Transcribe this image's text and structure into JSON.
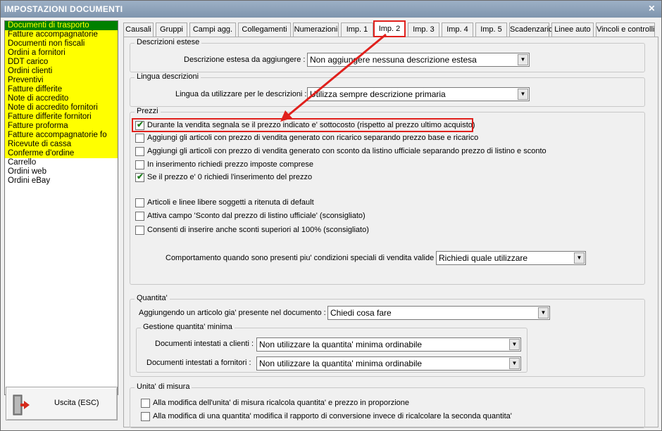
{
  "window": {
    "title": "IMPOSTAZIONI DOCUMENTI",
    "close_glyph": "✕"
  },
  "doc_types": [
    {
      "label": "Documenti di trasporto",
      "state": "selected"
    },
    {
      "label": "Fatture accompagnatorie",
      "state": "yellow"
    },
    {
      "label": "Documenti non fiscali",
      "state": "yellow"
    },
    {
      "label": "Ordini a fornitori",
      "state": "yellow"
    },
    {
      "label": "DDT carico",
      "state": "yellow"
    },
    {
      "label": "Ordini clienti",
      "state": "yellow"
    },
    {
      "label": "Preventivi",
      "state": "yellow"
    },
    {
      "label": "Fatture differite",
      "state": "yellow"
    },
    {
      "label": "Note di accredito",
      "state": "yellow"
    },
    {
      "label": "Note di accredito fornitori",
      "state": "yellow"
    },
    {
      "label": "Fatture differite fornitori",
      "state": "yellow"
    },
    {
      "label": "Fatture proforma",
      "state": "yellow"
    },
    {
      "label": "Fatture accompagnatorie fo",
      "state": "yellow"
    },
    {
      "label": "Ricevute di cassa",
      "state": "yellow"
    },
    {
      "label": "Conferme d'ordine",
      "state": "yellow"
    },
    {
      "label": "Carrello",
      "state": "plain"
    },
    {
      "label": "Ordini web",
      "state": "plain"
    },
    {
      "label": "Ordini eBay",
      "state": "plain"
    }
  ],
  "exit_button": {
    "label": "Uscita (ESC)",
    "icon": "exit-door-icon"
  },
  "tabs": [
    {
      "label": "Causali"
    },
    {
      "label": "Gruppi"
    },
    {
      "label": "Campi agg."
    },
    {
      "label": "Collegamenti"
    },
    {
      "label": "Numerazioni"
    },
    {
      "label": "Imp. 1"
    },
    {
      "label": "Imp. 2"
    },
    {
      "label": "Imp. 3"
    },
    {
      "label": "Imp. 4"
    },
    {
      "label": "Imp. 5"
    },
    {
      "label": "Scadenzario"
    },
    {
      "label": "Linee auto"
    },
    {
      "label": "Vincoli e controlli"
    }
  ],
  "active_tab": "Imp. 2",
  "descrizioni_estese": {
    "title": "Descrizioni estese",
    "label": "Descrizione estesa da aggiungere :",
    "value": "Non aggiungere nessuna descrizione estesa"
  },
  "lingua_descrizioni": {
    "title": "Lingua descrizioni",
    "label": "Lingua da utilizzare per le descrizioni :",
    "value": "Utilizza sempre descrizione primaria"
  },
  "prezzi": {
    "title": "Prezzi",
    "options": [
      {
        "label": "Durante la vendita segnala se il prezzo indicato e' sottocosto (rispetto al prezzo ultimo acquisto)",
        "checked": true
      },
      {
        "label": "Aggiungi gli articoli con prezzo di vendita generato con ricarico separando prezzo base e ricarico",
        "checked": false
      },
      {
        "label": "Aggiungi gli articoli con prezzo di vendita generato con sconto da listino ufficiale separando prezzo di listino e sconto",
        "checked": false
      },
      {
        "label": "In inserimento richiedi prezzo imposte comprese",
        "checked": false
      },
      {
        "label": "Se il prezzo e' 0 richiedi l'inserimento del prezzo",
        "checked": true
      },
      {
        "label": "Articoli e linee libere soggetti a ritenuta di default",
        "checked": false
      },
      {
        "label": "Attiva campo 'Sconto dal prezzo di listino ufficiale' (sconsigliato)",
        "checked": false
      },
      {
        "label": "Consenti di inserire anche sconti superiori al 100% (sconsigliato)",
        "checked": false
      }
    ],
    "condizioni_label": "Comportamento quando sono presenti piu' condizioni speciali di vendita valide :",
    "condizioni_value": "Richiedi quale utilizzare"
  },
  "quantita": {
    "title": "Quantita'",
    "label": "Aggiungendo un articolo gia' presente nel documento :",
    "value": "Chiedi cosa fare",
    "minima": {
      "title": "Gestione quantita' minima",
      "clienti_label": "Documenti intestati a clienti :",
      "clienti_value": "Non utilizzare la quantita' minima ordinabile",
      "fornitori_label": "Documenti intestati a fornitori :",
      "fornitori_value": "Non utilizzare la quantita' minima ordinabile"
    }
  },
  "unita_misura": {
    "title": "Unita' di misura",
    "options": [
      {
        "label": "Alla modifica dell'unita' di misura ricalcola quantita' e prezzo in proporzione",
        "checked": false
      },
      {
        "label": "Alla modifica di una quantita' modifica il rapporto di conversione invece di ricalcolare la seconda quantita'",
        "checked": false
      }
    ]
  },
  "colors": {
    "highlight": "#e0201c",
    "selected_bg": "#008000",
    "selected_fg": "#ffff00",
    "list_yellow": "#ffff00",
    "check_green": "#1e7d1e"
  }
}
